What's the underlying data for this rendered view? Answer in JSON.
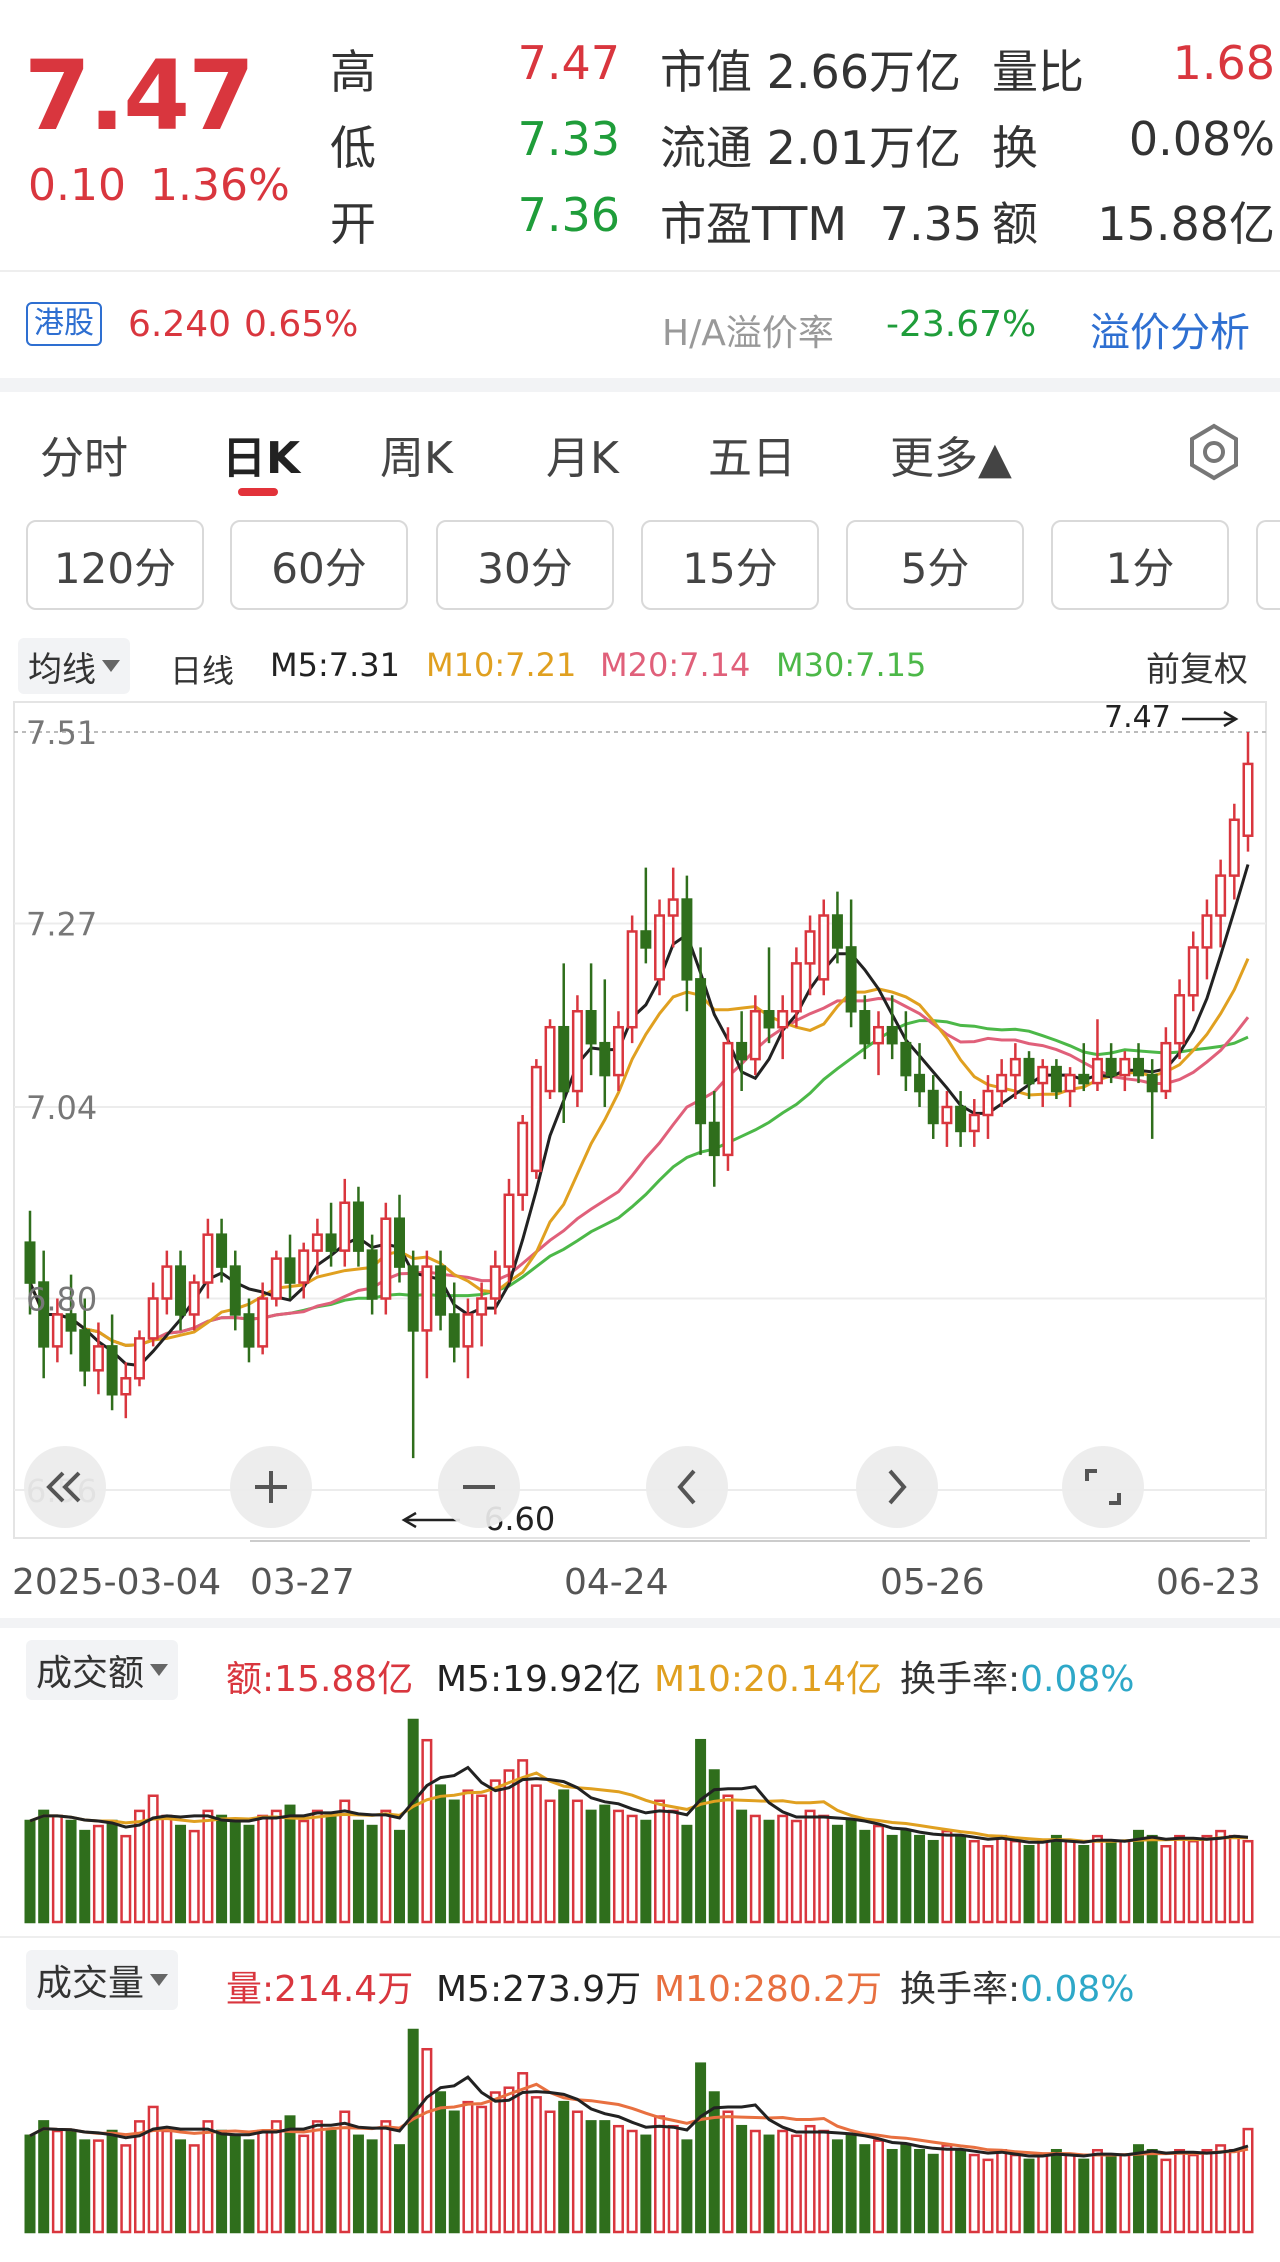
{
  "quote": {
    "price": "7.47",
    "change": "0.10",
    "change_pct": "1.36%",
    "stats": [
      {
        "label": "高",
        "value": "7.47",
        "color": "#d9363e"
      },
      {
        "label": "低",
        "value": "7.33",
        "color": "#1f9d3a"
      },
      {
        "label": "开",
        "value": "7.36",
        "color": "#1f9d3a"
      }
    ],
    "mid": [
      {
        "label": "市值",
        "value": "2.66万亿"
      },
      {
        "label": "流通",
        "value": "2.01万亿"
      },
      {
        "label": "市盈TTM",
        "value": "7.35"
      }
    ],
    "right": [
      {
        "label": "量比",
        "value": "1.68",
        "color": "#d9363e"
      },
      {
        "label": "换",
        "value": "0.08%",
        "color": "#333333"
      },
      {
        "label": "额",
        "value": "15.88亿",
        "color": "#333333"
      }
    ],
    "hk_label": "港股",
    "hk_price": "6.240",
    "hk_pct": "0.65%",
    "premium_label": "H/A溢价率",
    "premium_value": "-23.67%",
    "premium_link": "溢价分析"
  },
  "tabs": [
    {
      "label": "分时",
      "active": false
    },
    {
      "label": "日K",
      "active": true
    },
    {
      "label": "周K",
      "active": false
    },
    {
      "label": "月K",
      "active": false
    },
    {
      "label": "五日",
      "active": false
    },
    {
      "label": "更多▲",
      "active": false
    }
  ],
  "settings_icon": "gear-icon",
  "intervals": [
    "120分",
    "60分",
    "30分",
    "15分",
    "5分",
    "1分"
  ],
  "kline": {
    "dropdown": "均线",
    "period": "日线",
    "ma": [
      {
        "label": "M5:7.31",
        "color": "#222222"
      },
      {
        "label": "M10:7.21",
        "color": "#e0a020"
      },
      {
        "label": "M20:7.14",
        "color": "#e0607a"
      },
      {
        "label": "M30:7.15",
        "color": "#4cb848"
      }
    ],
    "adjust": "前复权",
    "y_ticks": [
      "7.51",
      "7.27",
      "7.04",
      "6.80",
      "6.56"
    ],
    "high_marker": "7.47",
    "low_marker": "6.60",
    "dates": [
      "2025-03-04",
      "03-27",
      "04-24",
      "05-26",
      "06-23"
    ],
    "colors": {
      "up": "#d9363e",
      "down": "#2f6e1c",
      "ma5": "#222222",
      "ma10": "#e0a020",
      "ma20": "#e0607a",
      "ma30": "#4cb848"
    }
  },
  "controls": [
    "double-left-icon",
    "plus-icon",
    "minus-icon",
    "chevron-left-icon",
    "chevron-right-icon",
    "fullscreen-icon"
  ],
  "amount_panel": {
    "dropdown": "成交额",
    "items": [
      {
        "label": "额:15.88亿",
        "color": "#d9363e"
      },
      {
        "label": "M5:19.92亿",
        "color": "#222222"
      },
      {
        "label": "M10:20.14亿",
        "color": "#e0a020"
      }
    ],
    "turnover_label": "换手率:",
    "turnover_value": "0.08%"
  },
  "volume_panel": {
    "dropdown": "成交量",
    "items": [
      {
        "label": "量:214.4万",
        "color": "#d9363e"
      },
      {
        "label": "M5:273.9万",
        "color": "#222222"
      },
      {
        "label": "M10:280.2万",
        "color": "#e87040"
      }
    ],
    "turnover_label": "换手率:",
    "turnover_value": "0.08%"
  },
  "chart_data": {
    "type": "candlestick",
    "title": "",
    "ylim": [
      6.56,
      7.51
    ],
    "ohlc": [
      [
        6.87,
        6.91,
        6.78,
        6.82
      ],
      [
        6.82,
        6.86,
        6.7,
        6.74
      ],
      [
        6.74,
        6.8,
        6.72,
        6.78
      ],
      [
        6.78,
        6.83,
        6.73,
        6.76
      ],
      [
        6.76,
        6.8,
        6.69,
        6.71
      ],
      [
        6.71,
        6.77,
        6.68,
        6.74
      ],
      [
        6.74,
        6.78,
        6.66,
        6.68
      ],
      [
        6.68,
        6.72,
        6.65,
        6.7
      ],
      [
        6.7,
        6.76,
        6.69,
        6.75
      ],
      [
        6.75,
        6.82,
        6.74,
        6.8
      ],
      [
        6.8,
        6.86,
        6.78,
        6.84
      ],
      [
        6.84,
        6.86,
        6.76,
        6.78
      ],
      [
        6.78,
        6.83,
        6.76,
        6.82
      ],
      [
        6.82,
        6.9,
        6.8,
        6.88
      ],
      [
        6.88,
        6.9,
        6.82,
        6.84
      ],
      [
        6.84,
        6.86,
        6.76,
        6.78
      ],
      [
        6.78,
        6.8,
        6.72,
        6.74
      ],
      [
        6.74,
        6.82,
        6.73,
        6.8
      ],
      [
        6.8,
        6.86,
        6.79,
        6.85
      ],
      [
        6.85,
        6.88,
        6.8,
        6.82
      ],
      [
        6.82,
        6.87,
        6.8,
        6.86
      ],
      [
        6.86,
        6.9,
        6.83,
        6.88
      ],
      [
        6.88,
        6.92,
        6.84,
        6.86
      ],
      [
        6.86,
        6.95,
        6.84,
        6.92
      ],
      [
        6.92,
        6.94,
        6.84,
        6.86
      ],
      [
        6.86,
        6.88,
        6.78,
        6.8
      ],
      [
        6.8,
        6.92,
        6.78,
        6.9
      ],
      [
        6.9,
        6.93,
        6.82,
        6.84
      ],
      [
        6.84,
        6.86,
        6.6,
        6.76
      ],
      [
        6.76,
        6.86,
        6.7,
        6.84
      ],
      [
        6.84,
        6.86,
        6.76,
        6.78
      ],
      [
        6.78,
        6.82,
        6.72,
        6.74
      ],
      [
        6.74,
        6.8,
        6.7,
        6.78
      ],
      [
        6.78,
        6.82,
        6.74,
        6.8
      ],
      [
        6.8,
        6.86,
        6.78,
        6.84
      ],
      [
        6.84,
        6.95,
        6.82,
        6.93
      ],
      [
        6.93,
        7.03,
        6.91,
        7.02
      ],
      [
        6.96,
        7.1,
        6.95,
        7.09
      ],
      [
        7.06,
        7.15,
        7.05,
        7.14
      ],
      [
        7.14,
        7.22,
        7.02,
        7.06
      ],
      [
        7.06,
        7.18,
        7.04,
        7.16
      ],
      [
        7.16,
        7.22,
        7.08,
        7.12
      ],
      [
        7.12,
        7.2,
        7.04,
        7.08
      ],
      [
        7.08,
        7.16,
        7.06,
        7.14
      ],
      [
        7.14,
        7.28,
        7.12,
        7.26
      ],
      [
        7.26,
        7.34,
        7.22,
        7.24
      ],
      [
        7.2,
        7.3,
        7.18,
        7.28
      ],
      [
        7.28,
        7.34,
        7.24,
        7.3
      ],
      [
        7.3,
        7.33,
        7.16,
        7.2
      ],
      [
        7.2,
        7.24,
        6.98,
        7.02
      ],
      [
        7.02,
        7.06,
        6.94,
        6.98
      ],
      [
        6.98,
        7.14,
        6.96,
        7.12
      ],
      [
        7.12,
        7.16,
        7.06,
        7.1
      ],
      [
        7.1,
        7.18,
        7.08,
        7.16
      ],
      [
        7.16,
        7.24,
        7.12,
        7.14
      ],
      [
        7.14,
        7.18,
        7.1,
        7.16
      ],
      [
        7.16,
        7.24,
        7.14,
        7.22
      ],
      [
        7.22,
        7.28,
        7.18,
        7.26
      ],
      [
        7.2,
        7.3,
        7.18,
        7.28
      ],
      [
        7.28,
        7.31,
        7.22,
        7.24
      ],
      [
        7.24,
        7.3,
        7.14,
        7.16
      ],
      [
        7.16,
        7.18,
        7.1,
        7.12
      ],
      [
        7.12,
        7.16,
        7.08,
        7.14
      ],
      [
        7.14,
        7.18,
        7.1,
        7.12
      ],
      [
        7.12,
        7.16,
        7.06,
        7.08
      ],
      [
        7.08,
        7.12,
        7.04,
        7.06
      ],
      [
        7.06,
        7.08,
        7.0,
        7.02
      ],
      [
        7.02,
        7.06,
        6.99,
        7.04
      ],
      [
        7.04,
        7.06,
        6.99,
        7.01
      ],
      [
        7.01,
        7.05,
        6.99,
        7.03
      ],
      [
        7.03,
        7.08,
        7.0,
        7.06
      ],
      [
        7.06,
        7.1,
        7.04,
        7.08
      ],
      [
        7.08,
        7.12,
        7.05,
        7.1
      ],
      [
        7.1,
        7.11,
        7.05,
        7.07
      ],
      [
        7.07,
        7.1,
        7.04,
        7.09
      ],
      [
        7.09,
        7.1,
        7.05,
        7.06
      ],
      [
        7.06,
        7.09,
        7.04,
        7.08
      ],
      [
        7.08,
        7.12,
        7.06,
        7.07
      ],
      [
        7.07,
        7.15,
        7.06,
        7.1
      ],
      [
        7.1,
        7.12,
        7.07,
        7.08
      ],
      [
        7.08,
        7.11,
        7.06,
        7.1
      ],
      [
        7.1,
        7.12,
        7.07,
        7.08
      ],
      [
        7.08,
        7.1,
        7.0,
        7.06
      ],
      [
        7.06,
        7.14,
        7.05,
        7.12
      ],
      [
        7.12,
        7.2,
        7.1,
        7.18
      ],
      [
        7.18,
        7.26,
        7.16,
        7.24
      ],
      [
        7.24,
        7.3,
        7.2,
        7.28
      ],
      [
        7.28,
        7.35,
        7.24,
        7.33
      ],
      [
        7.33,
        7.42,
        7.3,
        7.4
      ],
      [
        7.38,
        7.51,
        7.36,
        7.47
      ]
    ],
    "amount": [
      20,
      22,
      21,
      20,
      18,
      19,
      20,
      17,
      22,
      25,
      21,
      19,
      18,
      22,
      21,
      20,
      19,
      21,
      22,
      23,
      20,
      22,
      21,
      24,
      20,
      19,
      22,
      18,
      40,
      36,
      27,
      24,
      26,
      25,
      28,
      30,
      32,
      27,
      24,
      26,
      24,
      22,
      23,
      22,
      21,
      20,
      24,
      22,
      19,
      36,
      30,
      25,
      22,
      21,
      20,
      21,
      20,
      22,
      21,
      19,
      20,
      18,
      19,
      17,
      18,
      17,
      16,
      18,
      17,
      16,
      15,
      17,
      16,
      15,
      16,
      17,
      16,
      15,
      17,
      16,
      16,
      18,
      17,
      15,
      17,
      16,
      17,
      18,
      17,
      16
    ],
    "volume": [
      200,
      230,
      210,
      210,
      190,
      190,
      210,
      180,
      230,
      260,
      210,
      190,
      180,
      230,
      210,
      200,
      190,
      210,
      230,
      240,
      200,
      230,
      210,
      250,
      200,
      190,
      230,
      180,
      420,
      380,
      290,
      250,
      270,
      260,
      290,
      300,
      330,
      280,
      250,
      270,
      250,
      230,
      230,
      220,
      210,
      200,
      240,
      220,
      190,
      350,
      290,
      250,
      220,
      210,
      200,
      210,
      200,
      220,
      210,
      190,
      200,
      180,
      190,
      170,
      180,
      170,
      160,
      180,
      170,
      160,
      150,
      170,
      160,
      150,
      160,
      170,
      160,
      150,
      170,
      160,
      160,
      180,
      170,
      150,
      170,
      160,
      170,
      180,
      170,
      214
    ]
  }
}
